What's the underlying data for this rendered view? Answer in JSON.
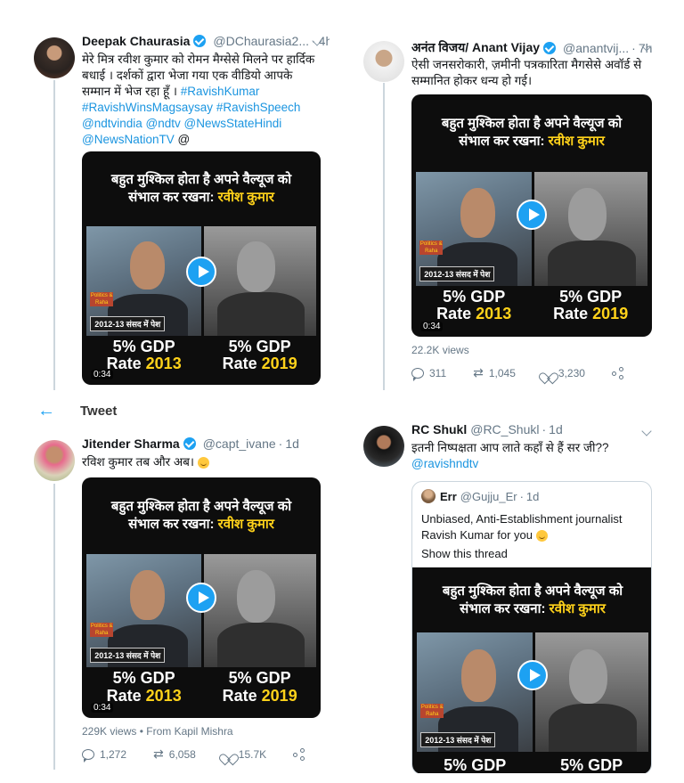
{
  "colors": {
    "brand": "#1da1f2",
    "link": "#1b95e0",
    "muted": "#657786",
    "video_highlight": "#ffd21a"
  },
  "video_card": {
    "headline_line1": "बहुत मुश्किल होता है अपने वैल्यूज को",
    "headline_line2_pre": "संभाल कर रखना:",
    "headline_line2_name": "रवीश कुमार",
    "caption": "2012-13 संसद में पेश",
    "logo": "Politics & Raha",
    "left_gdp": "5% GDP",
    "left_rate": "Rate",
    "left_year": "2013",
    "right_gdp": "5% GDP",
    "right_rate": "Rate",
    "right_year": "2019",
    "duration": "0:34"
  },
  "tweet1": {
    "name": "Deepak Chaurasia",
    "handle": "@DChaurasia2...",
    "time": "4h",
    "text": "मेरे मित्र रवीश कुमार को रोमन मैग्सेसे मिलने पर हार्दिक बधाई । दर्शकों द्वारा भेजा गया एक वीडियो आपके सम्मान में भेज रहा हूँ ।",
    "hashtag1": "#RavishKumar",
    "hashtag2": "#RavishWinsMagsaysay",
    "hashtag3": "#RavishSpeech",
    "mention1": "@ndtvindia",
    "mention2": "@ndtv",
    "mention3": "@NewsStateHindi",
    "mention4": "@NewsNationTV",
    "trailing": "@"
  },
  "tweet2": {
    "name": "अनंत विजय/ Anant Vijay",
    "handle": "@anantvij...",
    "time": "7h",
    "text": "ऐसी जनसरोकारी, ज़मीनी पत्रकारिता मैगसेसे अवॉर्ड से सम्मानित होकर धन्य हो गई।",
    "views": "22.2K views",
    "replies": "311",
    "retweets": "1,045",
    "likes": "3,230"
  },
  "tweet_bar": {
    "back_icon": "arrow-left-icon",
    "title": "Tweet"
  },
  "tweet3": {
    "name": "Jitender Sharma",
    "handle": "@capt_ivane",
    "time": "1d",
    "text": "रविश कुमार तब और अब।",
    "views": "229K views",
    "from": "• From Kapil Mishra",
    "replies": "1,272",
    "retweets": "6,058",
    "likes": "15.7K"
  },
  "tweet4": {
    "name": "RC Shukl",
    "handle": "@RC_Shukl",
    "time": "1d",
    "text": "इतनी निष्पक्षता आप लाते कहाँ से हैं सर जी??",
    "mention": "@ravishndtv",
    "quote": {
      "name": "Err",
      "handle": "@Gujju_Er",
      "time": "1d",
      "text": "Unbiased, Anti-Establishment journalist Ravish Kumar for you",
      "show_thread": "Show this thread"
    }
  }
}
